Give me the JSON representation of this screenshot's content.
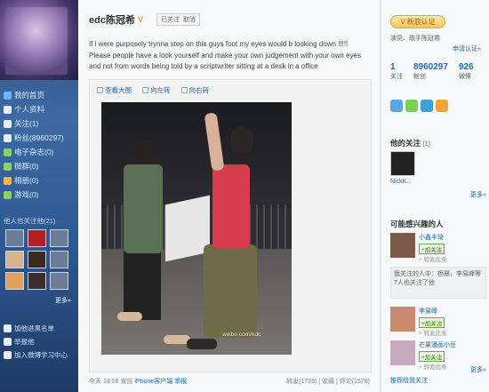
{
  "sidebar": {
    "nav": [
      {
        "label": "我的首页",
        "icon": "home-icon"
      },
      {
        "label": "个人资料",
        "icon": "profile-icon"
      },
      {
        "label": "关注(1)",
        "icon": "follow-icon"
      },
      {
        "label": "粉丝(8960297)",
        "icon": "fans-icon"
      },
      {
        "label": "电子杂志(0)",
        "icon": "magazine-icon"
      },
      {
        "label": "微群(0)",
        "icon": "group-icon"
      },
      {
        "label": "相册(0)",
        "icon": "album-icon"
      },
      {
        "label": "游戏(0)",
        "icon": "game-icon"
      }
    ],
    "followed_title": "他人也关注他(21)",
    "more": "更多»",
    "links": [
      {
        "label": "加他进黑名单"
      },
      {
        "label": "举报他"
      },
      {
        "label": "加入微博学习中心"
      }
    ]
  },
  "post": {
    "username": "edc陈冠希",
    "follow_status": "已关注",
    "cancel": "取消",
    "text": "If i were purposely trynna step on this guys foot my eyes would b looking down !!!!! Please people have a look yourself and make your own judgement with your own eyes and not from words being told by a scriptwriter sitting at a desk in a office",
    "tools": [
      "查看大图",
      "向左转",
      "向右转"
    ],
    "watermark": "weibo.com/edc",
    "time": "今天 14:58",
    "source_prefix": "来自",
    "source": "iPhone客户端",
    "report": "举报",
    "actions": "转发(1725) | 收藏 | 评论(1578)"
  },
  "right": {
    "verify_label": "新浪认证",
    "verify_desc": "演员、歌手陈冠希",
    "apply": "申请认证»",
    "stats": [
      {
        "num": "1",
        "label": "关注"
      },
      {
        "num": "8960297",
        "label": "粉丝"
      },
      {
        "num": "926",
        "label": "微博"
      }
    ],
    "his_follow_title": "他的关注",
    "his_follow_count": "(1)",
    "his_follow_name": "NickK..",
    "more": "更多»",
    "interest_title": "可能感兴趣的人",
    "interest_people": [
      {
        "name": "小鑫丰琦",
        "btn": "+加关注",
        "sub": "+ 转发此条"
      },
      {
        "name": "李易峰",
        "btn": "+加关注",
        "sub": "+ 转发此条"
      },
      {
        "name": "芒果漫画小豆",
        "btn": "+加关注",
        "sub": "+ 转发此条"
      }
    ],
    "common_text": "我关注的人中：杨幂，李易峰等 7人也关注了他",
    "rec_link": "推荐给我关注"
  }
}
